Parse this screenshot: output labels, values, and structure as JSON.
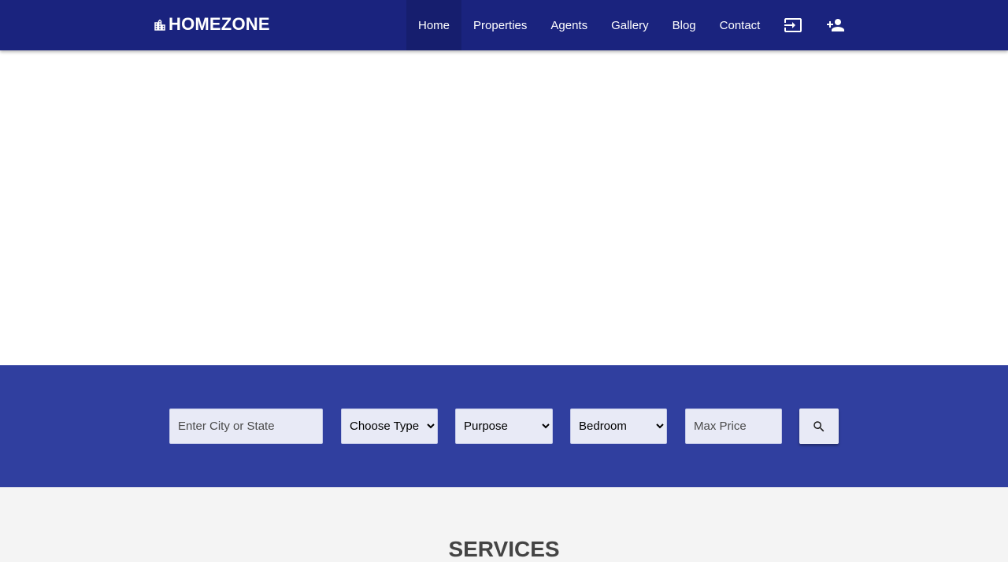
{
  "brand": {
    "name": "HOMEZONE",
    "icon": "city-buildings-icon"
  },
  "nav": {
    "links": [
      {
        "label": "Home",
        "active": true
      },
      {
        "label": "Properties",
        "active": false
      },
      {
        "label": "Agents",
        "active": false
      },
      {
        "label": "Gallery",
        "active": false
      },
      {
        "label": "Blog",
        "active": false
      },
      {
        "label": "Contact",
        "active": false
      }
    ],
    "icons": [
      "login-icon",
      "person-add-icon"
    ]
  },
  "search": {
    "location_placeholder": "Enter City or State",
    "type_selected": "Choose Type",
    "purpose_selected": "Purpose",
    "bedroom_selected": "Bedroom",
    "price_placeholder": "Max Price",
    "button_icon": "search-icon"
  },
  "services": {
    "title": "SERVICES"
  },
  "colors": {
    "navbar": "#1a237e",
    "search_band": "#303f9f",
    "field_bg": "#e8eaf6",
    "section_bg": "#f4f4f4",
    "title_text": "#444444"
  }
}
